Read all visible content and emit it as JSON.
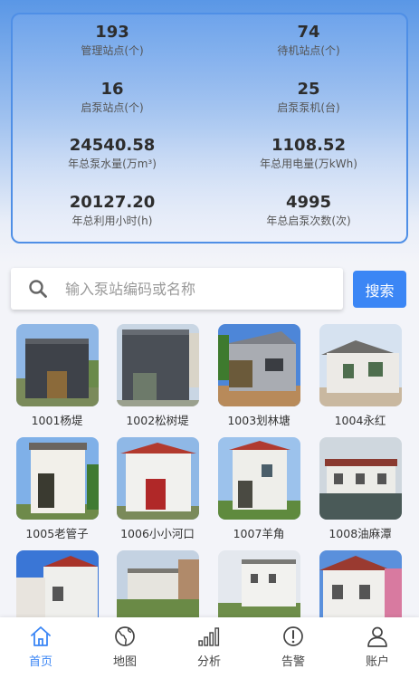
{
  "stats": [
    {
      "value": "193",
      "label": "管理站点(个)"
    },
    {
      "value": "74",
      "label": "待机站点(个)"
    },
    {
      "value": "16",
      "label": "启泵站点(个)"
    },
    {
      "value": "25",
      "label": "启泵泵机(台)"
    },
    {
      "value": "24540.58",
      "label": "年总泵水量(万m³)"
    },
    {
      "value": "1108.52",
      "label": "年总用电量(万kWh)"
    },
    {
      "value": "20127.20",
      "label": "年总利用小时(h)"
    },
    {
      "value": "4995",
      "label": "年总启泵次数(次)"
    }
  ],
  "search": {
    "placeholder": "输入泵站编码或名称",
    "button_label": "搜索",
    "icon": "search-icon"
  },
  "stations": [
    {
      "name": "1001杨堤"
    },
    {
      "name": "1002松树堤"
    },
    {
      "name": "1003划林塘"
    },
    {
      "name": "1004永红"
    },
    {
      "name": "1005老管子"
    },
    {
      "name": "1006小小河口"
    },
    {
      "name": "1007羊角"
    },
    {
      "name": "1008油麻潭"
    },
    {
      "name": ""
    },
    {
      "name": ""
    },
    {
      "name": ""
    },
    {
      "name": ""
    }
  ],
  "tabs": [
    {
      "label": "首页",
      "icon": "home-icon",
      "active": true
    },
    {
      "label": "地图",
      "icon": "globe-icon",
      "active": false
    },
    {
      "label": "分析",
      "icon": "signal-bars-icon",
      "active": false
    },
    {
      "label": "告警",
      "icon": "alert-icon",
      "active": false
    },
    {
      "label": "账户",
      "icon": "user-icon",
      "active": false
    }
  ],
  "colors": {
    "accent": "#3b86f5",
    "card_border": "#4f8fe6"
  }
}
